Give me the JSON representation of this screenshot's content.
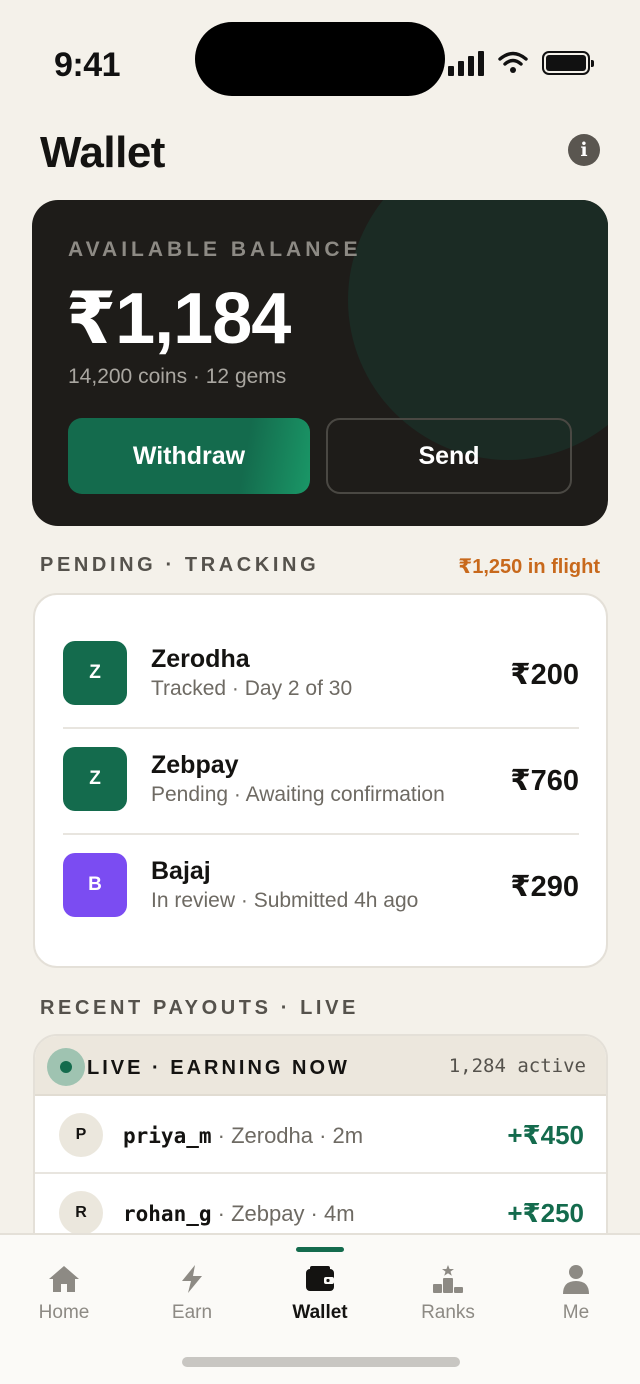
{
  "status_bar": {
    "time": "9:41"
  },
  "header": {
    "title": "Wallet",
    "info_icon": "info-icon"
  },
  "balance": {
    "label": "AVAILABLE BALANCE",
    "amount": "₹1,184",
    "sub": "14,200 coins · 12 gems",
    "withdraw_label": "Withdraw",
    "send_label": "Send"
  },
  "pending": {
    "title": "PENDING · TRACKING",
    "in_flight": "₹1,250 in flight",
    "items": [
      {
        "initial": "Z",
        "name": "Zerodha",
        "status": "Tracked · Day 2 of 30",
        "amount": "₹200",
        "color": "#146b4d"
      },
      {
        "initial": "Z",
        "name": "Zebpay",
        "status": "Pending · Awaiting confirmation",
        "amount": "₹760",
        "color": "#146b4d"
      },
      {
        "initial": "B",
        "name": "Bajaj",
        "status": "In review · Submitted 4h ago",
        "amount": "₹290",
        "color": "#7b4cf2"
      }
    ]
  },
  "payouts": {
    "title": "RECENT PAYOUTS · LIVE",
    "live_label": "LIVE · EARNING NOW",
    "active_count": "1,284 active",
    "items": [
      {
        "initial": "P",
        "user": "priya_m",
        "detail": " · Zerodha · 2m",
        "amount": "+₹450"
      },
      {
        "initial": "R",
        "user": "rohan_g",
        "detail": " · Zebpay · 4m",
        "amount": "+₹250"
      }
    ]
  },
  "tabs": [
    {
      "label": "Home",
      "icon": "home-icon",
      "active": false
    },
    {
      "label": "Earn",
      "icon": "bolt-icon",
      "active": false
    },
    {
      "label": "Wallet",
      "icon": "wallet-icon",
      "active": true
    },
    {
      "label": "Ranks",
      "icon": "podium-icon",
      "active": false
    },
    {
      "label": "Me",
      "icon": "person-icon",
      "active": false
    }
  ],
  "colors": {
    "accent": "#146b4d",
    "warning": "#c8691c",
    "card_dark": "#1e1c19",
    "background": "#f4f1ea"
  }
}
